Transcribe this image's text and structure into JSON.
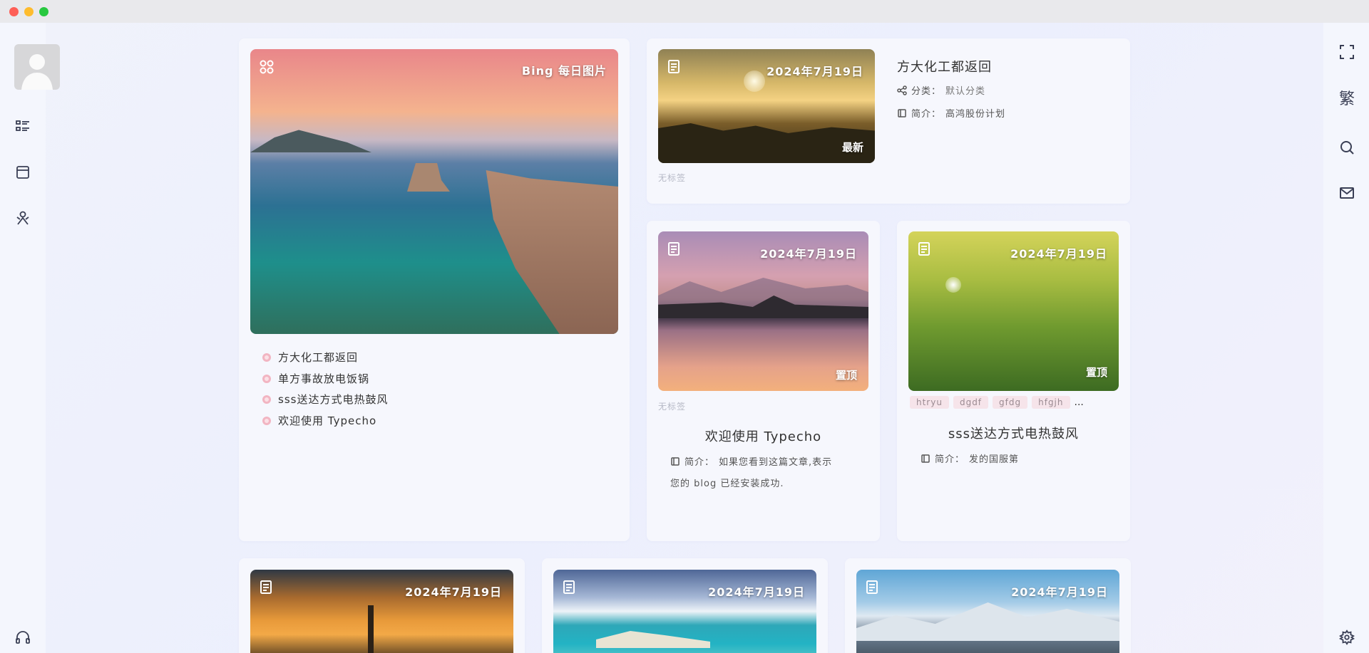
{
  "window": {
    "title": ""
  },
  "left_sidebar": {
    "items": [
      "list-icon",
      "archive-icon",
      "user-icon"
    ],
    "bottom": "headphones-icon"
  },
  "right_sidebar": {
    "fullscreen": "fullscreen-icon",
    "traditional_label": "繁",
    "search": "search-icon",
    "mail": "mail-icon",
    "settings": "gear-icon"
  },
  "bing_card": {
    "label": "Bing 每日图片",
    "list": [
      "方大化工都返回",
      "单方事故放电饭锅",
      "sss送达方式电热鼓风",
      "欢迎使用 Typecho"
    ]
  },
  "post_top": {
    "date": "2024年7月19日",
    "badge": "最新",
    "title": "方大化工都返回",
    "category_label": "分类：",
    "category_value": "默认分类",
    "intro_label": "简介：",
    "intro_value": "高鸿股份计划",
    "tags_empty": "无标签"
  },
  "post_typecho": {
    "date": "2024年7月19日",
    "badge": "置顶",
    "tags_empty": "无标签",
    "title": "欢迎使用 Typecho",
    "intro_label": "简介：",
    "intro_line1": "如果您看到这篇文章,表示",
    "intro_line2": "您的 blog 已经安装成功."
  },
  "post_sss": {
    "date": "2024年7月19日",
    "badge": "置顶",
    "tags": [
      "htryu",
      "dgdf",
      "gfdg",
      "hfgjh"
    ],
    "more": "...",
    "title": "sss送达方式电热鼓风",
    "intro_label": "简介：",
    "intro_value": "发的国服第"
  },
  "bottom_posts": [
    {
      "date": "2024年7月19日"
    },
    {
      "date": "2024年7月19日"
    },
    {
      "date": "2024年7月19日"
    }
  ],
  "colors": {
    "accent": "#f2b5c2",
    "background": "#eef0fb",
    "card": "#f6f7fd"
  }
}
